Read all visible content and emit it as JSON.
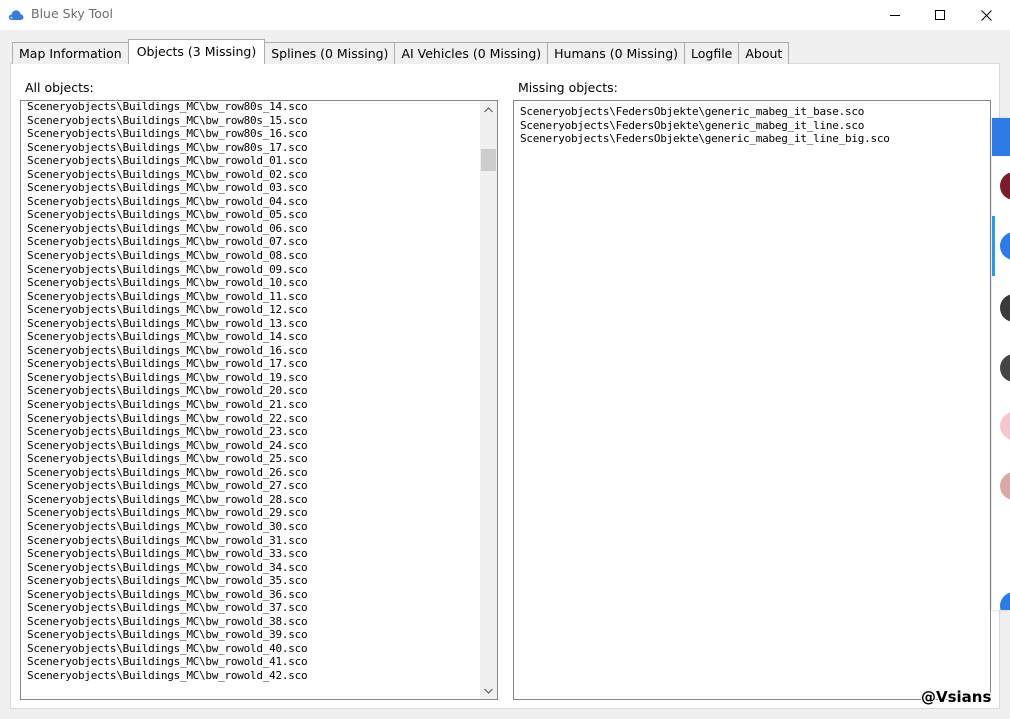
{
  "window": {
    "title": "Blue Sky Tool",
    "brand_color": "#3a7bd5"
  },
  "tabs": [
    {
      "label": "Map Information",
      "active": false
    },
    {
      "label": "Objects (3 Missing)",
      "active": true
    },
    {
      "label": "Splines (0 Missing)",
      "active": false
    },
    {
      "label": "AI Vehicles (0 Missing)",
      "active": false
    },
    {
      "label": "Humans (0 Missing)",
      "active": false
    },
    {
      "label": "Logfile",
      "active": false
    },
    {
      "label": "About",
      "active": false
    }
  ],
  "all_objects": {
    "label": "All objects:",
    "items": [
      "Sceneryobjects\\Buildings_MC\\bw_row80s_14.sco",
      "Sceneryobjects\\Buildings_MC\\bw_row80s_15.sco",
      "Sceneryobjects\\Buildings_MC\\bw_row80s_16.sco",
      "Sceneryobjects\\Buildings_MC\\bw_row80s_17.sco",
      "Sceneryobjects\\Buildings_MC\\bw_rowold_01.sco",
      "Sceneryobjects\\Buildings_MC\\bw_rowold_02.sco",
      "Sceneryobjects\\Buildings_MC\\bw_rowold_03.sco",
      "Sceneryobjects\\Buildings_MC\\bw_rowold_04.sco",
      "Sceneryobjects\\Buildings_MC\\bw_rowold_05.sco",
      "Sceneryobjects\\Buildings_MC\\bw_rowold_06.sco",
      "Sceneryobjects\\Buildings_MC\\bw_rowold_07.sco",
      "Sceneryobjects\\Buildings_MC\\bw_rowold_08.sco",
      "Sceneryobjects\\Buildings_MC\\bw_rowold_09.sco",
      "Sceneryobjects\\Buildings_MC\\bw_rowold_10.sco",
      "Sceneryobjects\\Buildings_MC\\bw_rowold_11.sco",
      "Sceneryobjects\\Buildings_MC\\bw_rowold_12.sco",
      "Sceneryobjects\\Buildings_MC\\bw_rowold_13.sco",
      "Sceneryobjects\\Buildings_MC\\bw_rowold_14.sco",
      "Sceneryobjects\\Buildings_MC\\bw_rowold_16.sco",
      "Sceneryobjects\\Buildings_MC\\bw_rowold_17.sco",
      "Sceneryobjects\\Buildings_MC\\bw_rowold_19.sco",
      "Sceneryobjects\\Buildings_MC\\bw_rowold_20.sco",
      "Sceneryobjects\\Buildings_MC\\bw_rowold_21.sco",
      "Sceneryobjects\\Buildings_MC\\bw_rowold_22.sco",
      "Sceneryobjects\\Buildings_MC\\bw_rowold_23.sco",
      "Sceneryobjects\\Buildings_MC\\bw_rowold_24.sco",
      "Sceneryobjects\\Buildings_MC\\bw_rowold_25.sco",
      "Sceneryobjects\\Buildings_MC\\bw_rowold_26.sco",
      "Sceneryobjects\\Buildings_MC\\bw_rowold_27.sco",
      "Sceneryobjects\\Buildings_MC\\bw_rowold_28.sco",
      "Sceneryobjects\\Buildings_MC\\bw_rowold_29.sco",
      "Sceneryobjects\\Buildings_MC\\bw_rowold_30.sco",
      "Sceneryobjects\\Buildings_MC\\bw_rowold_31.sco",
      "Sceneryobjects\\Buildings_MC\\bw_rowold_33.sco",
      "Sceneryobjects\\Buildings_MC\\bw_rowold_34.sco",
      "Sceneryobjects\\Buildings_MC\\bw_rowold_35.sco",
      "Sceneryobjects\\Buildings_MC\\bw_rowold_36.sco",
      "Sceneryobjects\\Buildings_MC\\bw_rowold_37.sco",
      "Sceneryobjects\\Buildings_MC\\bw_rowold_38.sco",
      "Sceneryobjects\\Buildings_MC\\bw_rowold_39.sco",
      "Sceneryobjects\\Buildings_MC\\bw_rowold_40.sco",
      "Sceneryobjects\\Buildings_MC\\bw_rowold_41.sco",
      "Sceneryobjects\\Buildings_MC\\bw_rowold_42.sco"
    ],
    "scroll_position": 0.18
  },
  "missing_objects": {
    "label": "Missing objects:",
    "items": [
      "Sceneryobjects\\FedersObjekte\\generic_mabeg_it_base.sco",
      "Sceneryobjects\\FedersObjekte\\generic_mabeg_it_line.sco",
      "Sceneryobjects\\FedersObjekte\\generic_mabeg_it_line_big.sco"
    ]
  },
  "watermark": "@Vsians",
  "icons": {
    "app": "cloud-icon",
    "minimize": "minimize-icon",
    "maximize": "maximize-icon",
    "close": "close-icon",
    "scroll_up": "chevron-up-icon",
    "scroll_down": "chevron-down-icon"
  }
}
